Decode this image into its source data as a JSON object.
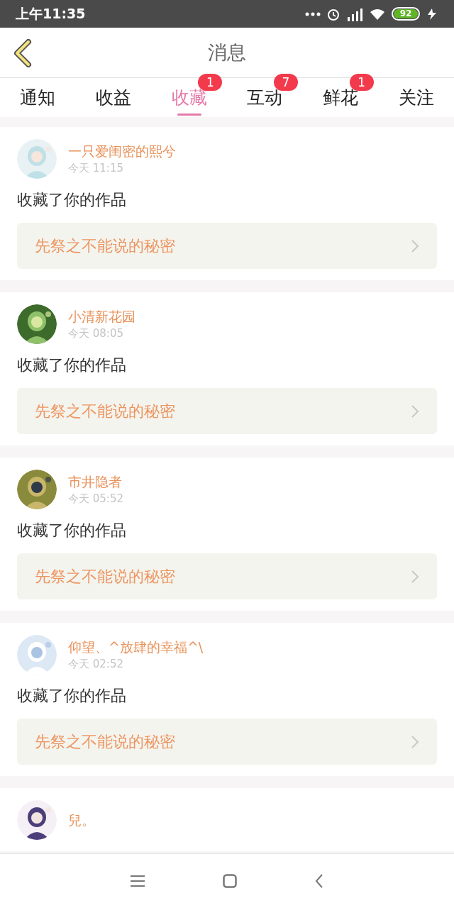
{
  "status_bar": {
    "time": "上午11:35",
    "battery": "92"
  },
  "header": {
    "title": "消息"
  },
  "tabs": [
    {
      "label": "通知",
      "selected": false
    },
    {
      "label": "收益",
      "selected": false
    },
    {
      "label": "收藏",
      "selected": true,
      "badge": "1"
    },
    {
      "label": "互动",
      "selected": false,
      "badge": "7"
    },
    {
      "label": "鲜花",
      "selected": false,
      "badge": "1"
    },
    {
      "label": "关注",
      "selected": false
    }
  ],
  "messages": [
    {
      "name": "一只爱闺密的熙兮",
      "time": "今天 11:15",
      "action": "收藏了你的作品",
      "work": "先祭之不能说的秘密"
    },
    {
      "name": "小清新花园",
      "time": "今天 08:05",
      "action": "收藏了你的作品",
      "work": "先祭之不能说的秘密"
    },
    {
      "name": "市井隐者",
      "time": "今天 05:52",
      "action": "收藏了你的作品",
      "work": "先祭之不能说的秘密"
    },
    {
      "name": "仰望、^放肆的幸福^\\",
      "time": "今天 02:52",
      "action": "收藏了你的作品",
      "work": "先祭之不能说的秘密"
    },
    {
      "name": "兒。"
    }
  ]
}
